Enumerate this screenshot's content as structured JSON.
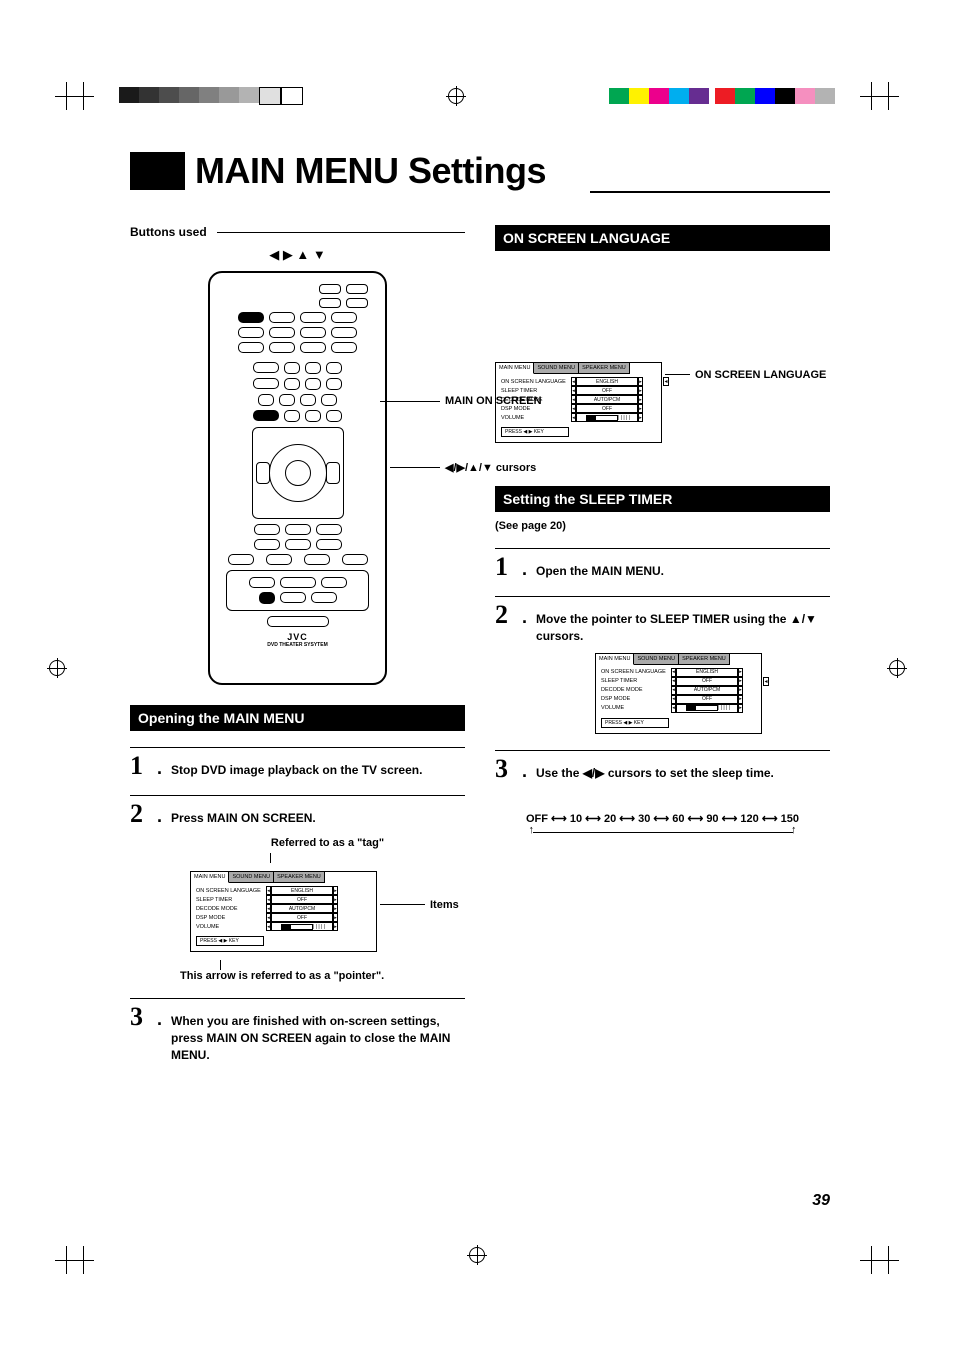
{
  "page_number": "39",
  "title": "MAIN MENU Settings",
  "left": {
    "buttons_used_label": "Buttons used",
    "cursor_glyphs": "◀ ▶ ▲ ▼",
    "callout_main_on_screen": "MAIN ON SCREEN",
    "callout_cursors": "◀/▶/▲/▼ cursors",
    "remote_brand": "JVC",
    "remote_model": "DVD THEATER SYSYTEM",
    "opening_header": "Opening the MAIN MENU",
    "step1": "Stop DVD image playback on the TV screen.",
    "step2": "Press MAIN ON SCREEN.",
    "tag_caption": "Referred to as a \"tag\"",
    "pointer_caption": "This arrow is referred to as a \"pointer\".",
    "items_label": "Items",
    "step3": "When you are finished with on-screen settings, press MAIN ON SCREEN again to close the MAIN MENU."
  },
  "right": {
    "lang_header": "ON SCREEN LANGUAGE",
    "lang_callout": "ON SCREEN LANGUAGE",
    "sleep_header": "Setting the SLEEP TIMER",
    "see_page": "(See page 20)",
    "step1": "Open the MAIN MENU.",
    "step2_a": "Move the pointer to SLEEP TIMER using the ",
    "step2_b": "▲/▼",
    "step2_c": " cursors.",
    "step3_a": "Use the ",
    "step3_b": "◀/▶",
    "step3_c": " cursors to set the sleep time.",
    "sleep_values": "OFF ⟷ 10 ⟷ 20 ⟷ 30 ⟷ 60 ⟷ 90 ⟷ 120 ⟷ 150"
  },
  "menu": {
    "tabs": [
      "MAIN MENU",
      "SOUND MENU",
      "SPEAKER MENU"
    ],
    "rows": [
      {
        "label": "ON SCREEN LANGUAGE",
        "value": "ENGLISH"
      },
      {
        "label": "SLEEP TIMER",
        "value": "OFF"
      },
      {
        "label": "DECODE MODE",
        "value": "AUTO/PCM"
      },
      {
        "label": "DSP MODE",
        "value": "OFF"
      },
      {
        "label": "VOLUME",
        "value": ""
      }
    ],
    "footer": "PRESS ◀ ▶ KEY"
  },
  "topbar": {
    "grey_swatches": [
      "#1a1a1a",
      "#333333",
      "#4d4d4d",
      "#666666",
      "#808080",
      "#999999",
      "#b3b3b3",
      "#e0e0e0",
      "#ffffff"
    ],
    "color_swatches_outer": [
      "#00a651",
      "#fff200",
      "#ec008c",
      "#00aeef",
      "#662d91"
    ],
    "color_swatches": [
      "#ed1c24",
      "#00a651",
      "#0000ff",
      "#000000",
      "#f58fbf",
      "#b3b3b3"
    ]
  }
}
